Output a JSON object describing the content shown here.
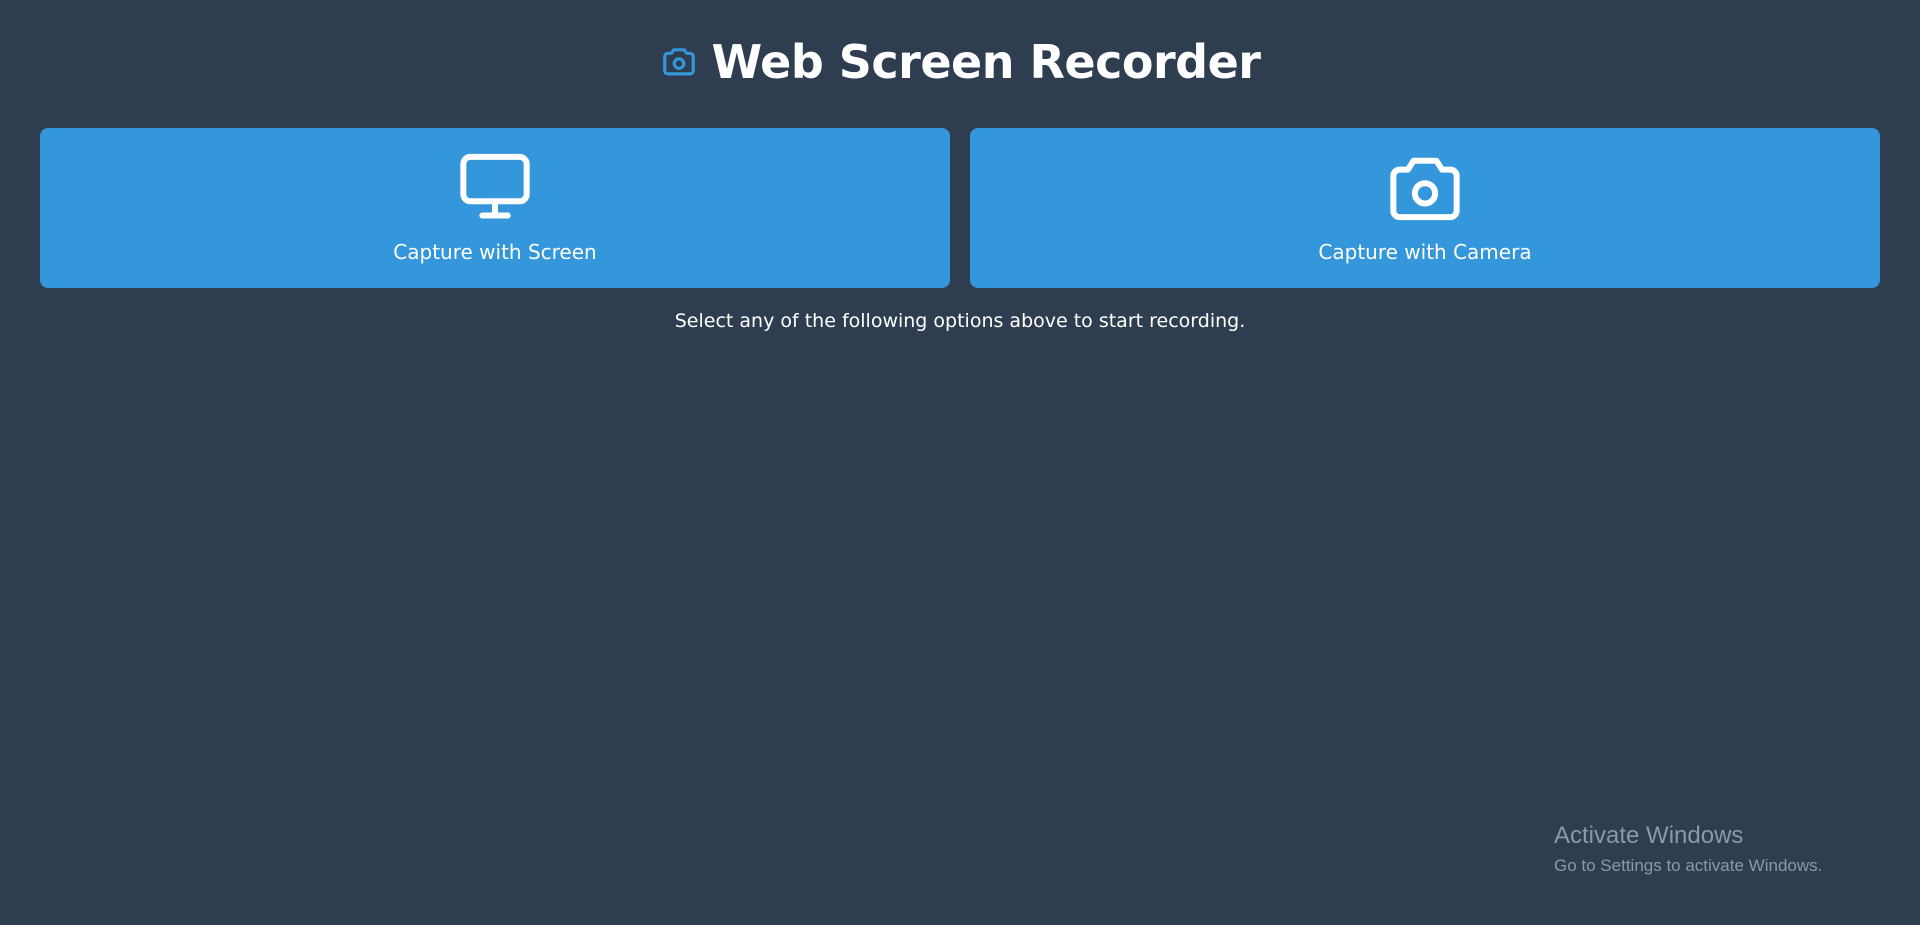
{
  "header": {
    "icon": "camera-icon",
    "title": "Web Screen Recorder"
  },
  "options": [
    {
      "icon": "monitor-icon",
      "label": "Capture with Screen"
    },
    {
      "icon": "camera-icon",
      "label": "Capture with Camera"
    }
  ],
  "hint": "Select any of the following options above to start recording.",
  "watermark": {
    "title": "Activate Windows",
    "subtitle": "Go to Settings to activate Windows."
  },
  "colors": {
    "background": "#2e3d50",
    "accent": "#3597db",
    "text": "#ffffff",
    "watermark": "#8d98a6"
  }
}
